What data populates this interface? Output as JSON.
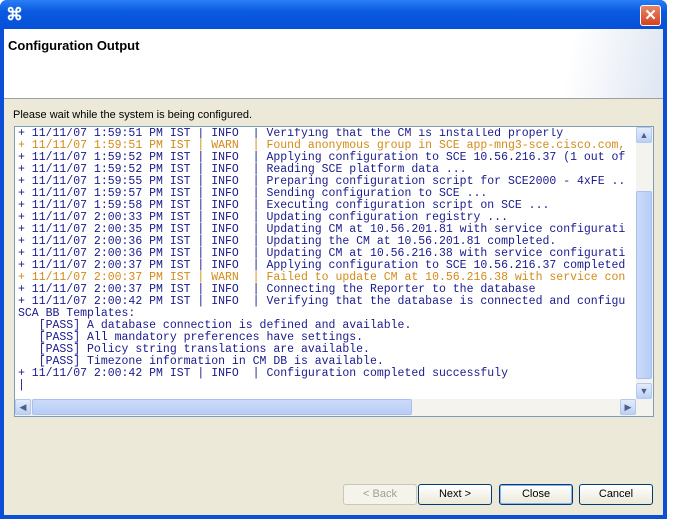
{
  "window": {
    "title": "",
    "close_icon": "close-x-icon",
    "app_icon": "app-logo-icon"
  },
  "header": {
    "title": "Configuration Output"
  },
  "message": "Please wait while the system is being configured.",
  "log": {
    "lines": [
      {
        "text": "+ 11/11/07 1:59:51 PM IST | INFO  | Verifying that the CM is installed properly",
        "level": "info"
      },
      {
        "text": "+ 11/11/07 1:59:51 PM IST | WARN  | Found anonymous group in SCE app-mng3-sce.cisco.com,",
        "level": "warn"
      },
      {
        "text": "+ 11/11/07 1:59:52 PM IST | INFO  | Applying configuration to SCE 10.56.216.37 (1 out of",
        "level": "info"
      },
      {
        "text": "+ 11/11/07 1:59:52 PM IST | INFO  | Reading SCE platform data ...",
        "level": "info"
      },
      {
        "text": "+ 11/11/07 1:59:55 PM IST | INFO  | Preparing configuration script for SCE2000 - 4xFE ..",
        "level": "info"
      },
      {
        "text": "+ 11/11/07 1:59:57 PM IST | INFO  | Sending configuration to SCE ...",
        "level": "info"
      },
      {
        "text": "+ 11/11/07 1:59:58 PM IST | INFO  | Executing configuration script on SCE ...",
        "level": "info"
      },
      {
        "text": "+ 11/11/07 2:00:33 PM IST | INFO  | Updating configuration registry ...",
        "level": "info"
      },
      {
        "text": "+ 11/11/07 2:00:35 PM IST | INFO  | Updating CM at 10.56.201.81 with service configurati",
        "level": "info"
      },
      {
        "text": "+ 11/11/07 2:00:36 PM IST | INFO  | Updating the CM at 10.56.201.81 completed.",
        "level": "info"
      },
      {
        "text": "+ 11/11/07 2:00:36 PM IST | INFO  | Updating CM at 10.56.216.38 with service configurati",
        "level": "info"
      },
      {
        "text": "+ 11/11/07 2:00:37 PM IST | INFO  | Applying configuration to SCE 10.56.216.37 completed",
        "level": "info"
      },
      {
        "text": "+ 11/11/07 2:00:37 PM IST | WARN  | Failed to update CM at 10.56.216.38 with service con",
        "level": "warn"
      },
      {
        "text": "+ 11/11/07 2:00:37 PM IST | INFO  | Connecting the Reporter to the database",
        "level": "info"
      },
      {
        "text": "+ 11/11/07 2:00:42 PM IST | INFO  | Verifying that the database is connected and configu",
        "level": "info"
      },
      {
        "text": "SCA BB Templates:",
        "level": "info"
      },
      {
        "text": "   [PASS] A database connection is defined and available.",
        "level": "info"
      },
      {
        "text": "   [PASS] All mandatory preferences have settings.",
        "level": "info"
      },
      {
        "text": "   [PASS] Policy string translations are available.",
        "level": "info"
      },
      {
        "text": "   [PASS] Timezone information in CM DB is available.",
        "level": "info"
      },
      {
        "text": "+ 11/11/07 2:00:42 PM IST | INFO  | Configuration completed successfuly",
        "level": "info"
      }
    ],
    "colors": {
      "info": "#1a1a8c",
      "warn": "#d48a1a"
    }
  },
  "buttons": {
    "back": "< Back",
    "next": "Next >",
    "close": "Close",
    "cancel": "Cancel"
  },
  "figure_id": "241896"
}
